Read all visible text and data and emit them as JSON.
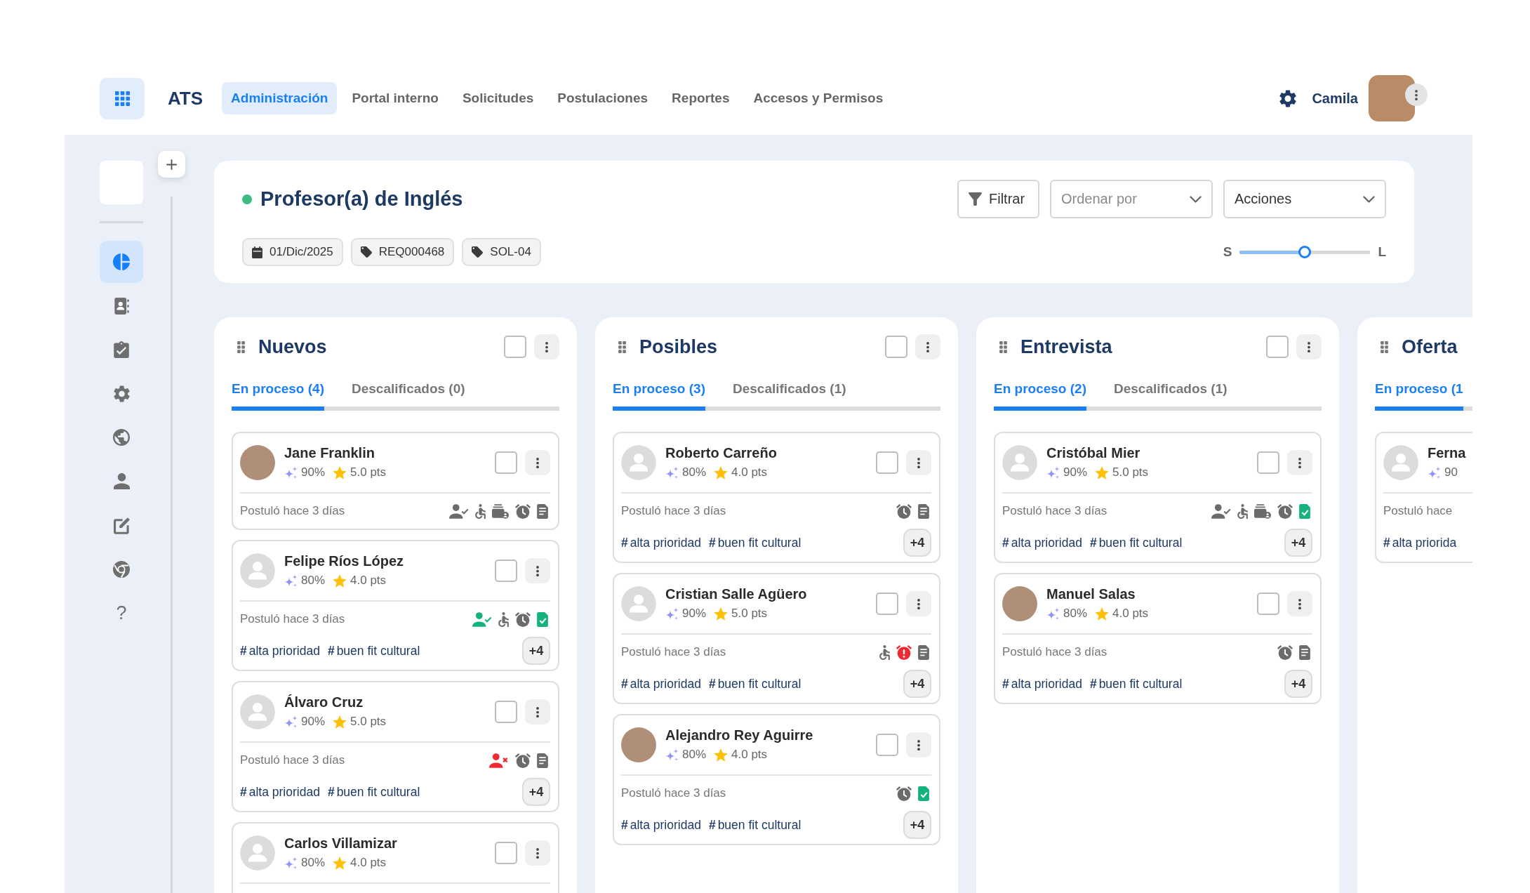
{
  "topbar": {
    "app_name": "ATS",
    "nav": [
      {
        "label": "Administración",
        "selected": true
      },
      {
        "label": "Portal interno",
        "selected": false
      },
      {
        "label": "Solicitudes",
        "selected": false
      },
      {
        "label": "Postulaciones",
        "selected": false
      },
      {
        "label": "Reportes",
        "selected": false
      },
      {
        "label": "Accesos y Permisos",
        "selected": false
      }
    ],
    "user_name": "Camila"
  },
  "sidebar": {
    "items": [
      {
        "kind": "dashboard",
        "selected": true
      },
      {
        "kind": "contacts",
        "selected": false
      },
      {
        "kind": "tasks",
        "selected": false
      },
      {
        "kind": "settings",
        "selected": false
      },
      {
        "kind": "web",
        "selected": false
      },
      {
        "kind": "profile",
        "selected": false
      },
      {
        "kind": "edit",
        "selected": false
      },
      {
        "kind": "browser",
        "selected": false
      },
      {
        "kind": "help",
        "label": "?",
        "selected": false
      }
    ]
  },
  "header": {
    "title": "Profesor(a) de Inglés",
    "active": true,
    "chips": [
      {
        "kind": "date",
        "label": "01/Dic/2025"
      },
      {
        "kind": "tag",
        "label": "REQ000468"
      },
      {
        "kind": "tag",
        "label": "SOL-04"
      }
    ],
    "filter_button": "Filtrar",
    "sort": {
      "placeholder": "Ordenar por"
    },
    "actions": {
      "value": "Acciones"
    },
    "size_slider": {
      "min_label": "S",
      "max_label": "L",
      "level": 0.5
    }
  },
  "columns": [
    {
      "title": "Nuevos",
      "checked": false,
      "tabs": [
        {
          "label": "En proceso (4)",
          "selected": true
        },
        {
          "label": "Descalificados (0)",
          "selected": false
        }
      ],
      "cards": [
        {
          "name": "Jane Franklin",
          "photo": true,
          "match": "90%",
          "score": "5.0 pts",
          "checked": false,
          "applied": "Postuló hace 3 días",
          "indicators": [
            {
              "kind": "user-check",
              "color": "#6b6b6b"
            },
            {
              "kind": "accessibility",
              "color": "#6b6b6b"
            },
            {
              "kind": "folder",
              "color": "#6b6b6b"
            },
            {
              "kind": "alarm",
              "color": "#6b6b6b"
            },
            {
              "kind": "document",
              "color": "#6b6b6b"
            }
          ]
        },
        {
          "name": "Felipe Ríos López",
          "photo": false,
          "match": "80%",
          "score": "4.0 pts",
          "checked": false,
          "applied": "Postuló hace 3 días",
          "indicators": [
            {
              "kind": "user-check",
              "color": "#15b27b"
            },
            {
              "kind": "accessibility",
              "color": "#6b6b6b"
            },
            {
              "kind": "alarm",
              "color": "#6b6b6b"
            },
            {
              "kind": "document-check",
              "color": "#15b27b"
            }
          ],
          "tags": [
            "**#**alta prioridad",
            "**#**buen fit cultural"
          ],
          "more": "+4"
        },
        {
          "name": "Álvaro Cruz",
          "photo": false,
          "match": "90%",
          "score": "5.0 pts",
          "checked": false,
          "applied": "Postuló hace 3 días",
          "indicators": [
            {
              "kind": "user-x",
              "color": "#ee2a31"
            },
            {
              "kind": "alarm",
              "color": "#6b6b6b"
            },
            {
              "kind": "document",
              "color": "#6b6b6b"
            }
          ],
          "tags": [
            "**#**alta prioridad",
            "**#**buen fit cultural"
          ],
          "more": "+4"
        },
        {
          "name": "Carlos Villamizar",
          "photo": false,
          "match": "80%",
          "score": "4.0 pts",
          "checked": false
        }
      ]
    },
    {
      "title": "Posibles",
      "checked": false,
      "tabs": [
        {
          "label": "En proceso (3)",
          "selected": true
        },
        {
          "label": "Descalificados (1)",
          "selected": false
        }
      ],
      "cards": [
        {
          "name": "Roberto Carreño",
          "photo": false,
          "match": "80%",
          "score": "4.0 pts",
          "checked": false,
          "applied": "Postuló hace 3 días",
          "indicators": [
            {
              "kind": "alarm",
              "color": "#6b6b6b"
            },
            {
              "kind": "document",
              "color": "#6b6b6b"
            }
          ],
          "tags": [
            "**#**alta prioridad",
            "**#**buen fit cultural"
          ],
          "more": "+4"
        },
        {
          "name": "Cristian Salle Agüero",
          "photo": false,
          "match": "90%",
          "score": "5.0 pts",
          "checked": false,
          "applied": "Postuló hace 3 días",
          "indicators": [
            {
              "kind": "accessibility",
              "color": "#6b6b6b"
            },
            {
              "kind": "alarm-alert",
              "color": "#ee2a31"
            },
            {
              "kind": "document",
              "color": "#6b6b6b"
            }
          ],
          "tags": [
            "**#**alta prioridad",
            "**#**buen fit cultural"
          ],
          "more": "+4"
        },
        {
          "name": "Alejandro Rey Aguirre",
          "photo": true,
          "match": "80%",
          "score": "4.0 pts",
          "checked": false,
          "applied": "Postuló hace 3 días",
          "indicators": [
            {
              "kind": "alarm",
              "color": "#6b6b6b"
            },
            {
              "kind": "document-check",
              "color": "#15b27b"
            }
          ],
          "tags": [
            "**#**alta prioridad",
            "**#**buen fit cultural"
          ],
          "more": "+4"
        }
      ]
    },
    {
      "title": "Entrevista",
      "checked": false,
      "tabs": [
        {
          "label": "En proceso (2)",
          "selected": true
        },
        {
          "label": "Descalificados (1)",
          "selected": false
        }
      ],
      "cards": [
        {
          "name": "Cristóbal Mier",
          "photo": false,
          "match": "90%",
          "score": "5.0 pts",
          "checked": false,
          "applied": "Postuló hace 3 días",
          "indicators": [
            {
              "kind": "user-check",
              "color": "#6b6b6b"
            },
            {
              "kind": "accessibility",
              "color": "#6b6b6b"
            },
            {
              "kind": "folder",
              "color": "#6b6b6b"
            },
            {
              "kind": "alarm",
              "color": "#6b6b6b"
            },
            {
              "kind": "document-check",
              "color": "#15b27b"
            }
          ],
          "tags": [
            "**#**alta prioridad",
            "**#**buen fit cultural"
          ],
          "more": "+4"
        },
        {
          "name": "Manuel Salas",
          "photo": true,
          "match": "80%",
          "score": "4.0 pts",
          "checked": false,
          "applied": "Postuló hace 3 días",
          "indicators": [
            {
              "kind": "alarm",
              "color": "#6b6b6b"
            },
            {
              "kind": "document",
              "color": "#6b6b6b"
            }
          ],
          "tags": [
            "**#**alta prioridad",
            "**#**buen fit cultural"
          ],
          "more": "+4"
        }
      ]
    },
    {
      "title": "Oferta",
      "tabs": [
        {
          "label": "En proceso (1",
          "selected": true
        }
      ],
      "cards": [
        {
          "name": "Ferna",
          "photo": false,
          "match": "90",
          "applied": "Postuló hace",
          "tags": [
            "**#**alta priorida"
          ]
        }
      ]
    }
  ]
}
